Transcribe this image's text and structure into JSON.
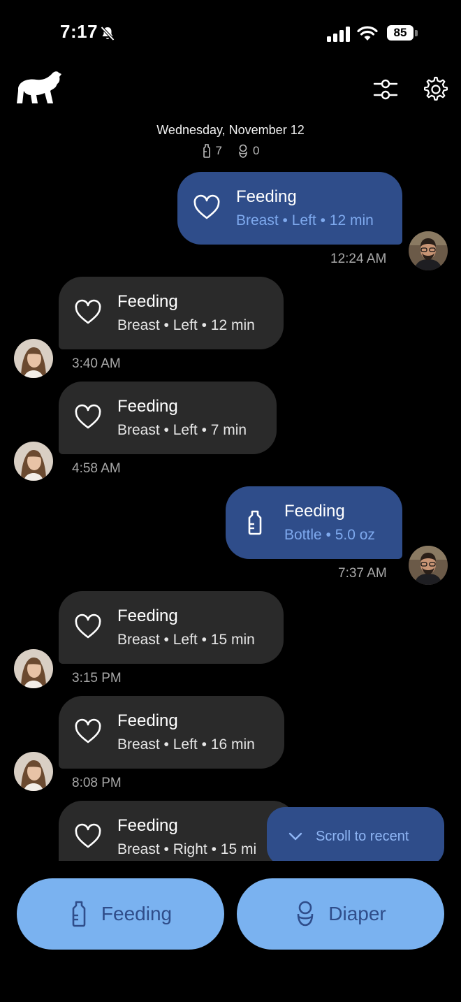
{
  "status_bar": {
    "time": "7:17",
    "battery": "85"
  },
  "header": {
    "date": "Wednesday, November 12",
    "feeding_count": "7",
    "diaper_count": "0"
  },
  "entries": [
    {
      "title": "Feeding",
      "detail": "Breast • Left • 12 min",
      "time": "12:24 AM",
      "author": "me",
      "icon": "heart-icon"
    },
    {
      "title": "Feeding",
      "detail": "Breast • Left • 12 min",
      "time": "3:40 AM",
      "author": "partner",
      "icon": "heart-icon"
    },
    {
      "title": "Feeding",
      "detail": "Breast • Left • 7 min",
      "time": "4:58 AM",
      "author": "partner",
      "icon": "heart-icon"
    },
    {
      "title": "Feeding",
      "detail": "Bottle • 5.0 oz",
      "time": "7:37 AM",
      "author": "me",
      "icon": "bottle-icon"
    },
    {
      "title": "Feeding",
      "detail": "Breast • Left • 15 min",
      "time": "3:15 PM",
      "author": "partner",
      "icon": "heart-icon"
    },
    {
      "title": "Feeding",
      "detail": "Breast • Left • 16 min",
      "time": "8:08 PM",
      "author": "partner",
      "icon": "heart-icon"
    },
    {
      "title": "Feeding",
      "detail": "Breast • Right • 15 mi",
      "time": "",
      "author": "partner",
      "icon": "heart-icon"
    }
  ],
  "scroll_button": {
    "label": "Scroll to recent"
  },
  "actions": {
    "feeding_label": "Feeding",
    "diaper_label": "Diaper"
  },
  "colors": {
    "accent": "#7ab2f0",
    "mine_bubble": "#2f4d8a",
    "theirs_bubble": "#2a2a2a"
  }
}
